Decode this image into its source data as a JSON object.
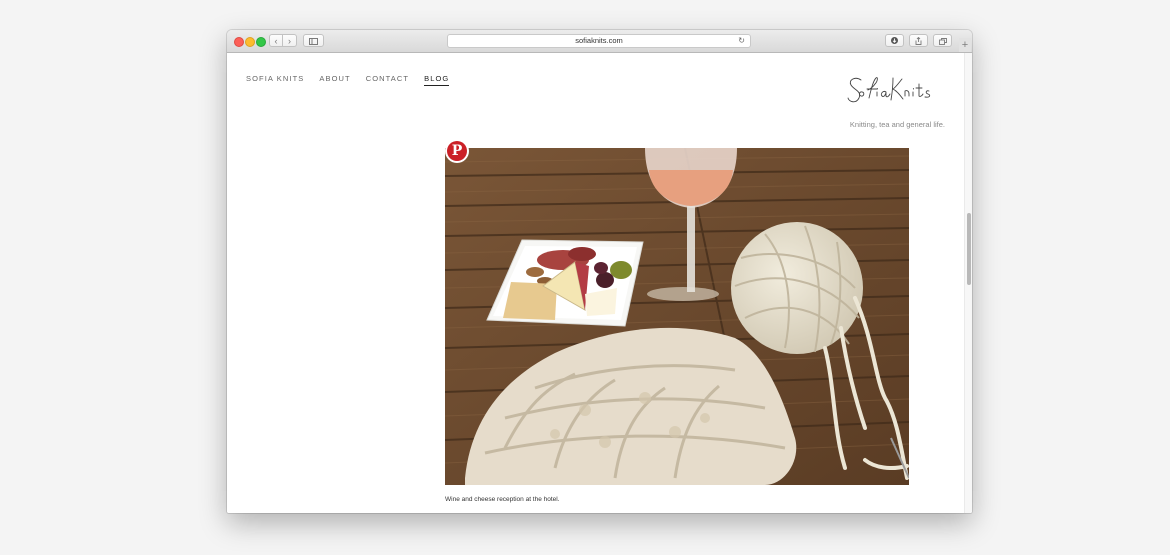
{
  "browser": {
    "url": "sofiaknits.com",
    "back_icon": "chevron-left-icon",
    "forward_icon": "chevron-right-icon",
    "sidebar_icon": "sidebar-icon",
    "reload_icon": "reload-icon",
    "download_icon": "download-icon",
    "share_icon": "share-icon",
    "tabs_icon": "tabs-icon",
    "new_tab_label": "+"
  },
  "nav": {
    "items": [
      {
        "label": "Sofia Knits"
      },
      {
        "label": "About"
      },
      {
        "label": "Contact"
      },
      {
        "label": "Blog"
      }
    ],
    "active": "Blog"
  },
  "header": {
    "logo_text": "SofiaKnits",
    "tagline": "Knitting, tea and general life."
  },
  "post": {
    "pin_label": "P",
    "caption": "Wine and cheese reception at the hotel."
  },
  "colors": {
    "pinterest": "#cb2027",
    "active_nav": "#222222"
  }
}
